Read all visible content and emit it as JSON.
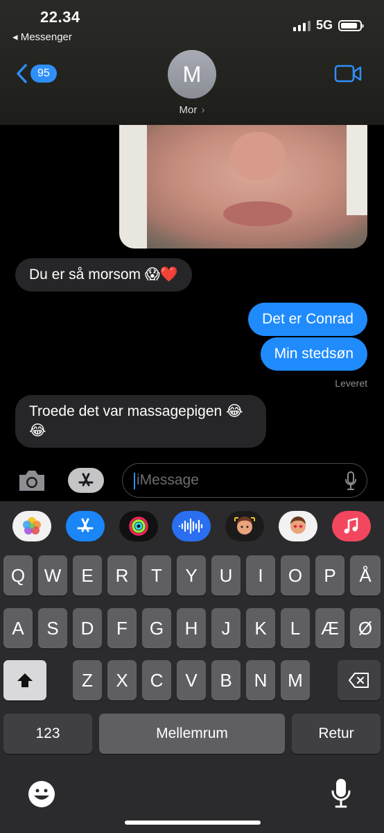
{
  "status_bar": {
    "time": "22.34",
    "back_app": "◂ Messenger",
    "network": "5G"
  },
  "header": {
    "back_count": "95",
    "avatar_initial": "M",
    "contact_name": "Mor",
    "contact_chevron": "›"
  },
  "messages": [
    {
      "direction": "in",
      "text": "Du er så morsom 😱❤️"
    },
    {
      "direction": "out",
      "text": "Det er Conrad"
    },
    {
      "direction": "out",
      "text": "Min stedsøn"
    },
    {
      "direction": "in",
      "text": "Troede det var massagepigen 😂😂"
    }
  ],
  "delivered_label": "Leveret",
  "input": {
    "placeholder": "iMessage"
  },
  "app_strip": [
    "photos-icon",
    "appstore-icon",
    "activity-icon",
    "audio-icon",
    "memoji-icon",
    "memoji-sticker-icon",
    "music-icon"
  ],
  "keyboard": {
    "row1": [
      "Q",
      "W",
      "E",
      "R",
      "T",
      "Y",
      "U",
      "I",
      "O",
      "P",
      "Å"
    ],
    "row2": [
      "A",
      "S",
      "D",
      "F",
      "G",
      "H",
      "J",
      "K",
      "L",
      "Æ",
      "Ø"
    ],
    "row3": [
      "Z",
      "X",
      "C",
      "V",
      "B",
      "N",
      "M"
    ],
    "numbers_label": "123",
    "space_label": "Mellemrum",
    "return_label": "Retur"
  },
  "colors": {
    "accent": "#1f8bfd",
    "incoming_bubble": "#262628",
    "keyboard_bg": "#2b2b2d",
    "key": "#5f5f63"
  }
}
